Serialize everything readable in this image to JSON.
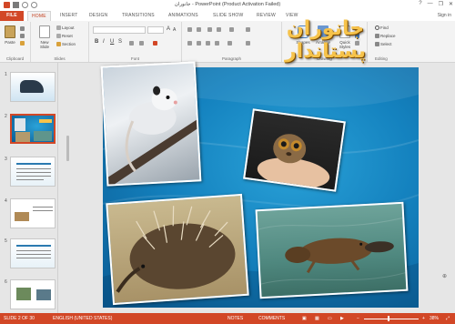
{
  "window": {
    "title": "جانوران - PowerPoint (Product Activation Failed)",
    "controls": [
      "?",
      "—",
      "❐",
      "✕"
    ]
  },
  "tabs": [
    {
      "label": "FILE"
    },
    {
      "label": "HOME"
    },
    {
      "label": "INSERT"
    },
    {
      "label": "DESIGN"
    },
    {
      "label": "TRANSITIONS"
    },
    {
      "label": "ANIMATIONS"
    },
    {
      "label": "SLIDE SHOW"
    },
    {
      "label": "REVIEW"
    },
    {
      "label": "VIEW"
    }
  ],
  "signin": "Sign in",
  "ribbon": {
    "clipboard": {
      "paste": "Paste",
      "label": "Clipboard"
    },
    "slides": {
      "new_slide": "New Slide",
      "layout": "Layout",
      "reset": "Reset",
      "section": "Section",
      "label": "Slides"
    },
    "font": {
      "label": "Font",
      "bold": "B",
      "italic": "I",
      "underline": "U",
      "strike": "S"
    },
    "paragraph": {
      "label": "Paragraph"
    },
    "drawing": {
      "shapes": "Shapes",
      "arrange": "Arrange",
      "quick_styles": "Quick Styles",
      "label": "Drawing"
    },
    "editing": {
      "find": "Find",
      "replace": "Replace",
      "select": "Select",
      "label": "Editing"
    }
  },
  "slides_panel": {
    "numbers": [
      "1",
      "2",
      "3",
      "4",
      "5",
      "6"
    ],
    "selected_index": 1
  },
  "slide": {
    "title": "جانوران پستاندار"
  },
  "statusbar": {
    "slide_info": "SLIDE 2 OF 30",
    "language": "ENGLISH (UNITED STATES)",
    "notes": "NOTES",
    "comments": "COMMENTS",
    "zoom": "38%"
  },
  "colors": {
    "accent": "#d24726",
    "slide_bg": "#1482bf",
    "title_text": "#f6c34b"
  }
}
